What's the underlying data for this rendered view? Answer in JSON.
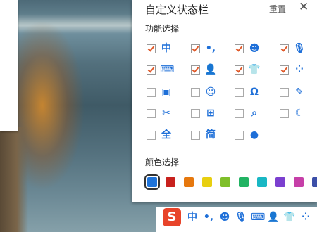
{
  "panel": {
    "title": "自定义状态栏",
    "reset_label": "重置",
    "close_glyph": "✕",
    "function_section_label": "功能选择",
    "color_section_label": "颜色选择"
  },
  "options": [
    {
      "icon": "chinese-char-icon",
      "glyph": "中",
      "checked": true
    },
    {
      "icon": "punctuation-icon",
      "glyph": "•,",
      "checked": true
    },
    {
      "icon": "smiley-icon",
      "glyph": "☻",
      "checked": true
    },
    {
      "icon": "microphone-icon",
      "glyph": "🎙",
      "checked": true
    },
    {
      "icon": "keyboard-icon",
      "glyph": "⌨",
      "checked": true
    },
    {
      "icon": "user-icon",
      "glyph": "👤",
      "checked": true
    },
    {
      "icon": "tshirt-icon",
      "glyph": "👕",
      "checked": true
    },
    {
      "icon": "toolbox-grid-icon",
      "glyph": "⁘",
      "checked": true
    },
    {
      "icon": "clipboard-icon",
      "glyph": "▣",
      "checked": false
    },
    {
      "icon": "emoticon-box-icon",
      "glyph": "☺",
      "checked": false
    },
    {
      "icon": "omega-icon",
      "glyph": "Ω",
      "checked": false
    },
    {
      "icon": "pencil-icon",
      "glyph": "✎",
      "checked": false
    },
    {
      "icon": "scissors-icon",
      "glyph": "✂",
      "checked": false
    },
    {
      "icon": "image-add-icon",
      "glyph": "⊞",
      "checked": false
    },
    {
      "icon": "search-icon",
      "glyph": "⌕",
      "checked": false
    },
    {
      "icon": "moon-icon",
      "glyph": "☾",
      "checked": false
    },
    {
      "icon": "full-width-icon",
      "glyph": "全",
      "checked": false
    },
    {
      "icon": "simplified-icon",
      "glyph": "简",
      "checked": false
    },
    {
      "icon": "mascot-icon",
      "glyph": "●",
      "checked": false
    }
  ],
  "colors": [
    {
      "hex": "#1e73d9",
      "selected": true
    },
    {
      "hex": "#c8211d",
      "selected": false
    },
    {
      "hex": "#e6780e",
      "selected": false
    },
    {
      "hex": "#e8cf10",
      "selected": false
    },
    {
      "hex": "#7fbf2a",
      "selected": false
    },
    {
      "hex": "#22b363",
      "selected": false
    },
    {
      "hex": "#19b7c4",
      "selected": false
    },
    {
      "hex": "#7b3fcf",
      "selected": false
    },
    {
      "hex": "#c63fa8",
      "selected": false
    },
    {
      "hex": "#3c4fa8",
      "selected": false
    }
  ],
  "taskbar": {
    "logo_glyph": "S",
    "items": [
      {
        "icon": "chinese-char-icon",
        "glyph": "中"
      },
      {
        "icon": "punctuation-icon",
        "glyph": "•,"
      },
      {
        "icon": "smiley-icon",
        "glyph": "☻"
      },
      {
        "icon": "microphone-icon",
        "glyph": "🎙"
      },
      {
        "icon": "keyboard-icon",
        "glyph": "⌨"
      },
      {
        "icon": "user-icon",
        "glyph": "👤"
      },
      {
        "icon": "tshirt-icon",
        "glyph": "👕"
      },
      {
        "icon": "toolbox-grid-icon",
        "glyph": "⁘"
      }
    ]
  }
}
